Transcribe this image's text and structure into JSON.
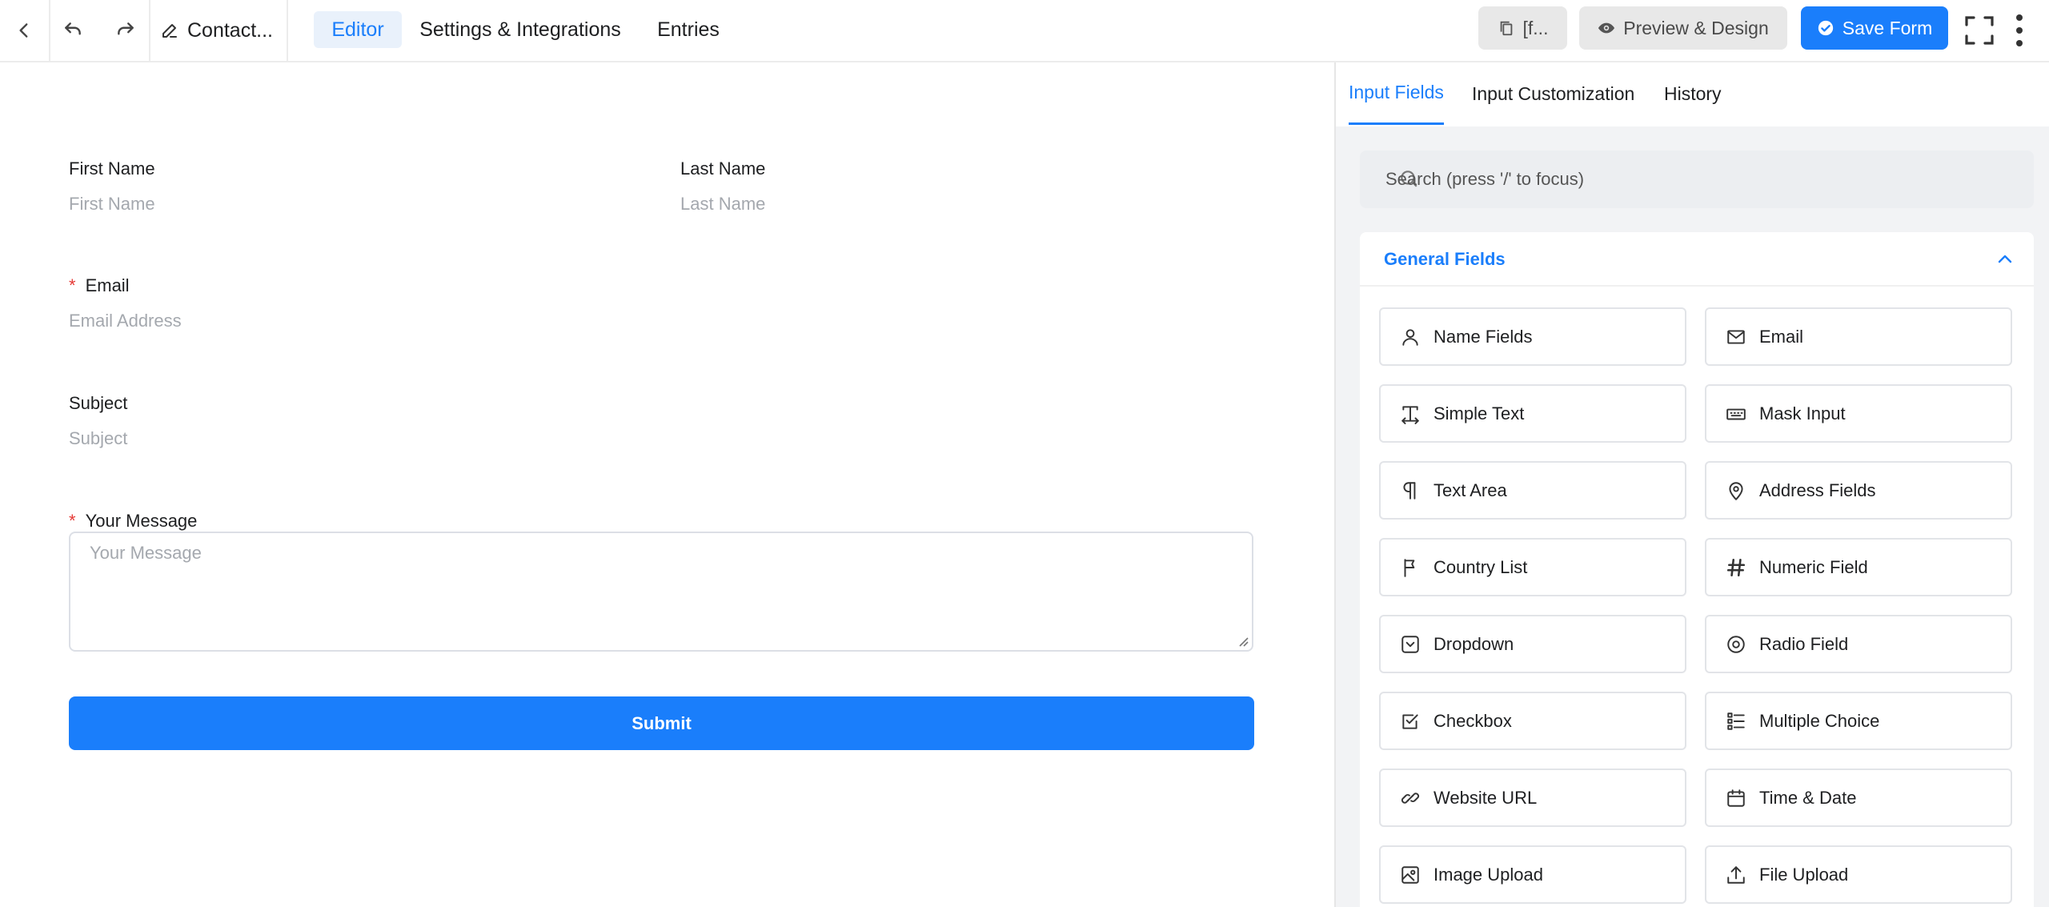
{
  "topbar": {
    "form_title": "Contact...",
    "tabs": [
      "Editor",
      "Settings & Integrations",
      "Entries"
    ],
    "shortcode_label": "[f...",
    "preview_label": "Preview & Design",
    "save_label": "Save Form"
  },
  "form": {
    "first_name": {
      "label": "First Name",
      "placeholder": "First Name"
    },
    "last_name": {
      "label": "Last Name",
      "placeholder": "Last Name"
    },
    "email": {
      "label": "Email",
      "placeholder": "Email Address",
      "required_mark": "*"
    },
    "subject": {
      "label": "Subject",
      "placeholder": "Subject"
    },
    "message": {
      "label": "Your Message",
      "placeholder": "Your Message",
      "required_mark": "*"
    },
    "submit_label": "Submit"
  },
  "panel": {
    "tabs": [
      "Input Fields",
      "Input Customization",
      "History"
    ],
    "search_placeholder": "Search (press '/' to focus)",
    "group_title": "General Fields",
    "fields": [
      {
        "label": "Name Fields",
        "icon": "user-icon"
      },
      {
        "label": "Email",
        "icon": "envelope-icon"
      },
      {
        "label": "Simple Text",
        "icon": "text-cursor-icon"
      },
      {
        "label": "Mask Input",
        "icon": "keyboard-icon"
      },
      {
        "label": "Text Area",
        "icon": "paragraph-icon"
      },
      {
        "label": "Address Fields",
        "icon": "map-pin-icon"
      },
      {
        "label": "Country List",
        "icon": "flag-icon"
      },
      {
        "label": "Numeric Field",
        "icon": "hash-icon"
      },
      {
        "label": "Dropdown",
        "icon": "dropdown-icon"
      },
      {
        "label": "Radio Field",
        "icon": "radio-icon"
      },
      {
        "label": "Checkbox",
        "icon": "checkbox-icon"
      },
      {
        "label": "Multiple Choice",
        "icon": "list-check-icon"
      },
      {
        "label": "Website URL",
        "icon": "link-icon"
      },
      {
        "label": "Time & Date",
        "icon": "calendar-icon"
      },
      {
        "label": "Image Upload",
        "icon": "image-icon"
      },
      {
        "label": "File Upload",
        "icon": "upload-icon"
      }
    ]
  },
  "colors": {
    "accent": "#1a7efb",
    "required": "#e53935",
    "placeholder": "#a4a8ae"
  }
}
